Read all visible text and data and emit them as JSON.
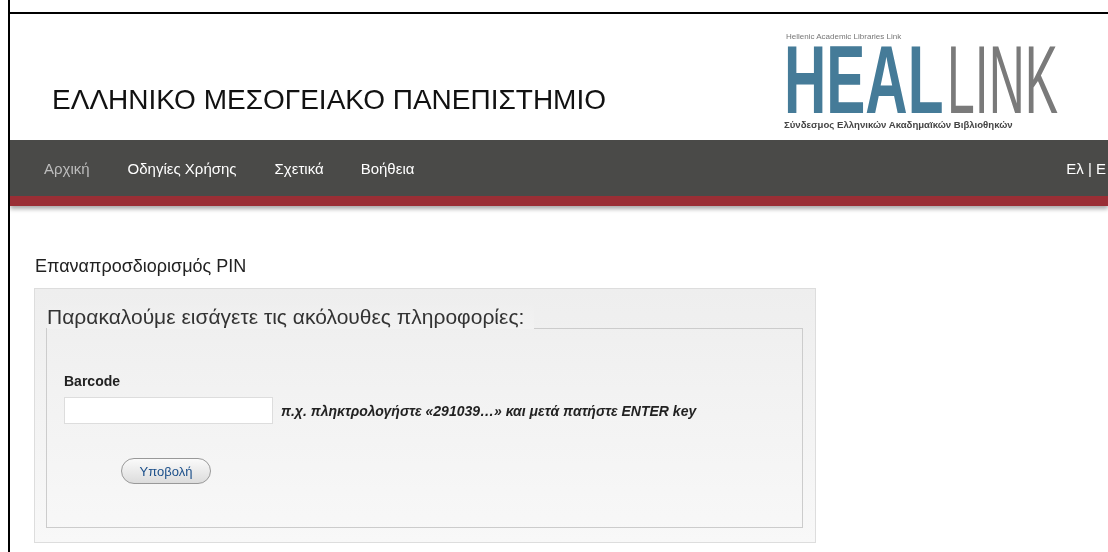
{
  "header": {
    "title": "ΕΛΛΗΝΙΚΟ ΜΕΣΟΓΕΙΑΚΟ ΠΑΝΕΠΙΣΤΗΜΙΟ",
    "logo": {
      "tagline": "Hellenic Academic Libraries Link",
      "word_part_1": "HEAL",
      "word_part_2": "LINK",
      "subtitle": "Σύνδεσμος Ελληνικών Ακαδημαϊκών Βιβλιοθηκών"
    }
  },
  "nav": {
    "items": [
      {
        "label": "Αρχική",
        "selected": true
      },
      {
        "label": "Οδηγίες Χρήσης",
        "selected": false
      },
      {
        "label": "Σχετικά",
        "selected": false
      },
      {
        "label": "Βοήθεια",
        "selected": false
      }
    ],
    "language": "Ελ | E"
  },
  "page_title": "Επαναπροσδιορισμός PIN",
  "form": {
    "legend": "Παρακαλούμε εισάγετε τις ακόλουθες πληροφορίες:",
    "field_label": "Barcode",
    "hint": "π.χ. πληκτρολογήστε «291039…» και μετά πατήστε ENTER key",
    "submit": "Υποβολή"
  }
}
